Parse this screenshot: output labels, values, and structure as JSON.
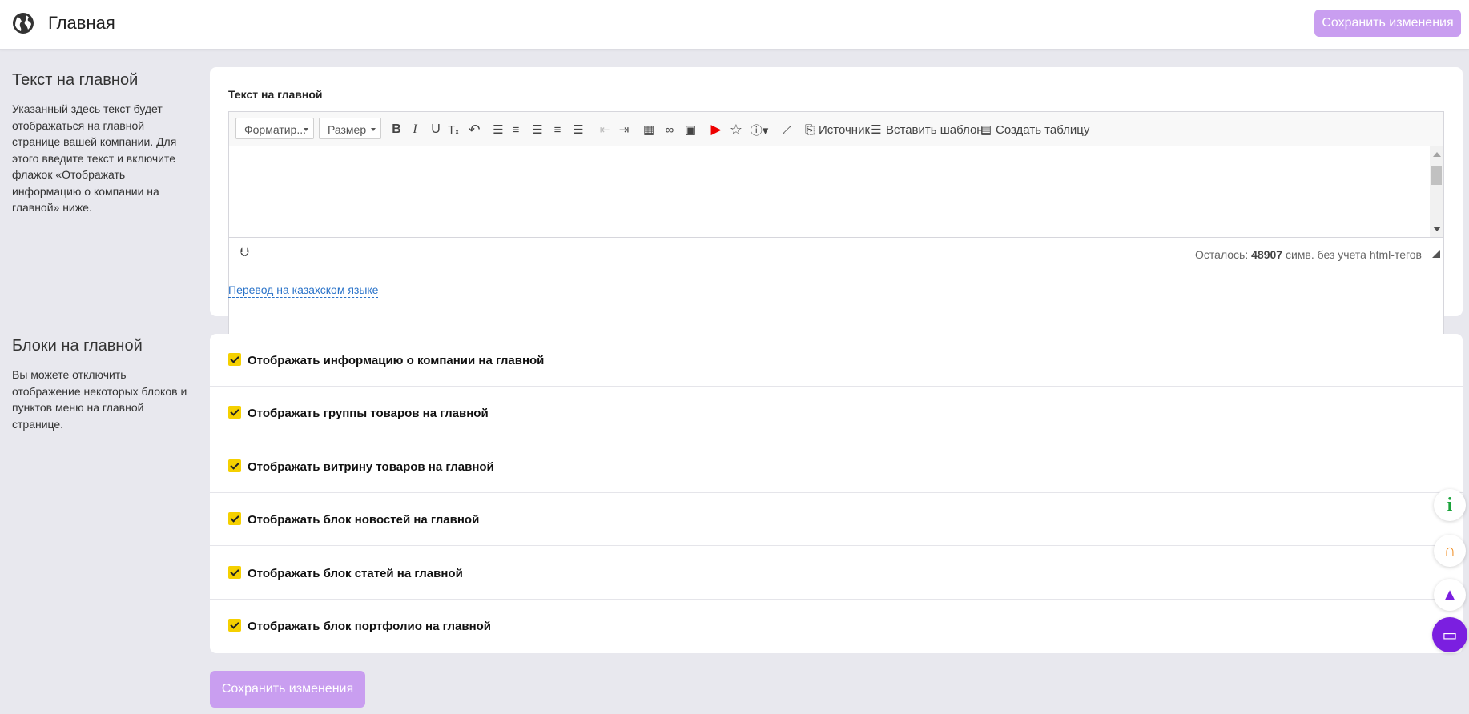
{
  "header": {
    "title": "Главная",
    "save_label": "Сохранить изменения"
  },
  "section_text": {
    "title": "Текст на главной",
    "description": "Указанный здесь текст будет отображаться на главной странице вашей компании. Для этого введите текст и включите флажок «Отображать информацию о компании на главной» ниже.",
    "field_label": "Текст на главной",
    "toolbar": {
      "format_label": "Форматир...",
      "size_label": "Размер",
      "bold": "B",
      "italic": "I",
      "underline": "U",
      "source_label": "Источник",
      "template_label": "Вставить шаблон",
      "table_label": "Создать таблицу"
    },
    "status": {
      "prefix": "Осталось:",
      "count": "48907",
      "suffix": "симв. без учета html-тегов"
    },
    "translation_link": "Перевод на казахском языке"
  },
  "section_blocks": {
    "title": "Блоки на главной",
    "description": "Вы можете отключить отображение некоторых блоков и пунктов меню на главной странице.",
    "options": [
      {
        "label": "Отображать информацию о компании на главной",
        "checked": true
      },
      {
        "label": "Отображать группы товаров на главной",
        "checked": true
      },
      {
        "label": "Отображать витрину товаров на главной",
        "checked": true
      },
      {
        "label": "Отображать блок новостей на главной",
        "checked": true
      },
      {
        "label": "Отображать блок статей на главной",
        "checked": true
      },
      {
        "label": "Отображать блок портфолио на главной",
        "checked": true
      }
    ]
  },
  "footer": {
    "save_label": "Сохранить изменения"
  },
  "colors": {
    "accent": "#c99ef0",
    "checkbox": "#f5d000",
    "link": "#2a73c9",
    "chat": "#7b1fe0"
  }
}
